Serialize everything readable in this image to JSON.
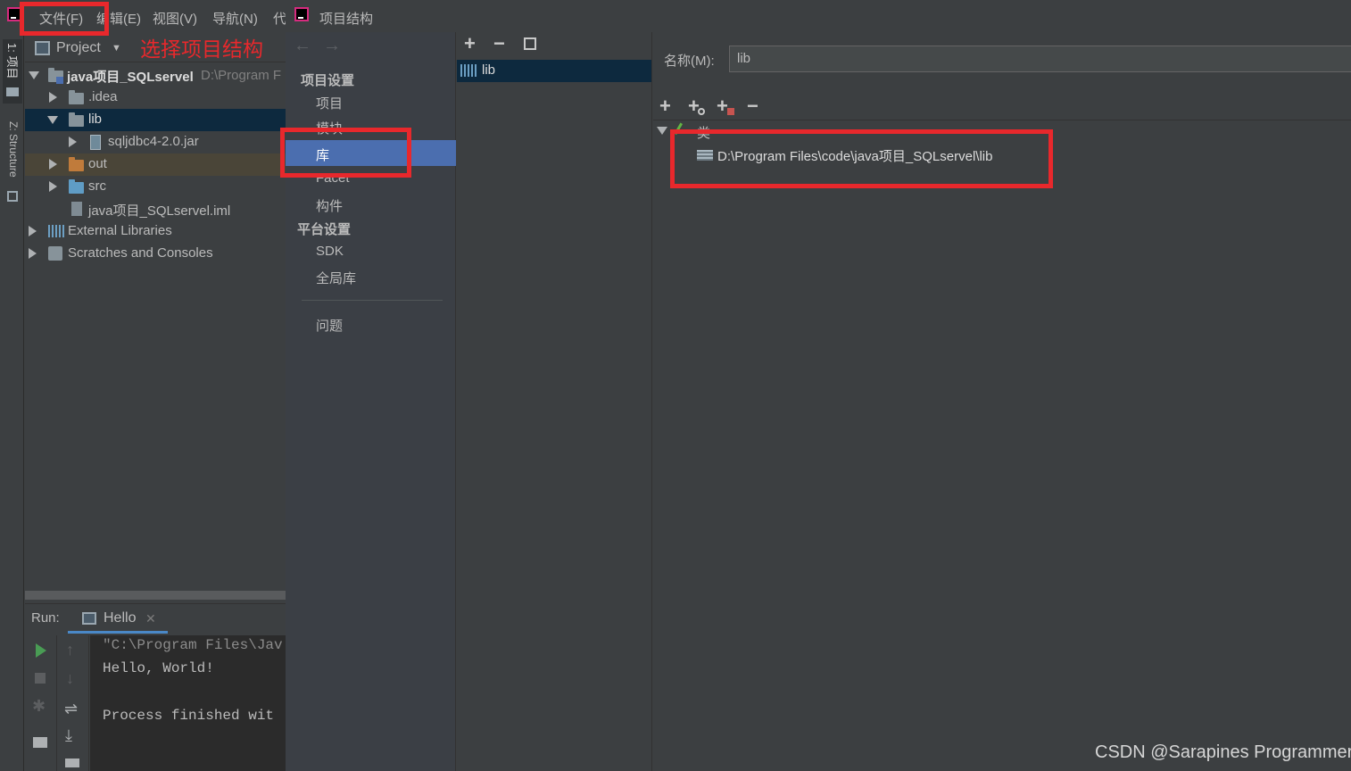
{
  "menubar": {
    "items": [
      "文件(F)",
      "编辑(E)",
      "视图(V)",
      "导航(N)",
      "代"
    ],
    "dialog_title": "项目结构"
  },
  "annotation": {
    "text": "选择项目结构",
    "color": "#e8282c"
  },
  "left_strip": {
    "project_tab": "1: 项目",
    "structure_tab": "Z: Structure"
  },
  "project_panel": {
    "dropdown_label": "Project",
    "tree": [
      {
        "name": "java项目_SQLserve",
        "suffix": "l",
        "path_hint": "D:\\Program F"
      },
      {
        "name": ".idea"
      },
      {
        "name": "lib"
      },
      {
        "name": "sqljdbc4-2.0.jar"
      },
      {
        "name": "out"
      },
      {
        "name": "src"
      },
      {
        "name": "java项目_SQLserve",
        "suffix": "l.iml"
      },
      {
        "name": "External Libraries"
      },
      {
        "name": "Scratches and Consoles"
      }
    ]
  },
  "run_panel": {
    "label": "Run:",
    "tab_name": "Hello",
    "console_lines": [
      "\"C:\\Program Files\\Jav",
      "Hello, World!",
      "",
      "Process finished wit"
    ]
  },
  "nav_panel": {
    "section_project": "项目设置",
    "items_project": [
      "项目",
      "模块",
      "库",
      "Facet",
      "构件"
    ],
    "section_platform": "平台设置",
    "items_platform": [
      "SDK",
      "全局库"
    ],
    "problems": "问题"
  },
  "library_list": {
    "items": [
      "lib"
    ]
  },
  "detail_panel": {
    "name_label": "名称(M):",
    "name_value": "lib",
    "tree_root": "类",
    "path": "D:\\Program Files\\code\\java项目_SQLserve",
    "path_suffix": "l\\lib"
  },
  "watermark": "CSDN @Sarapines Programmer",
  "colors": {
    "selection": "#4b6eaf",
    "selection_tree": "#0d293e",
    "red": "#e8282c",
    "folder_blue": "#87939a",
    "folder_orange": "#c07b3b",
    "folder_src": "#5f9cc5"
  }
}
